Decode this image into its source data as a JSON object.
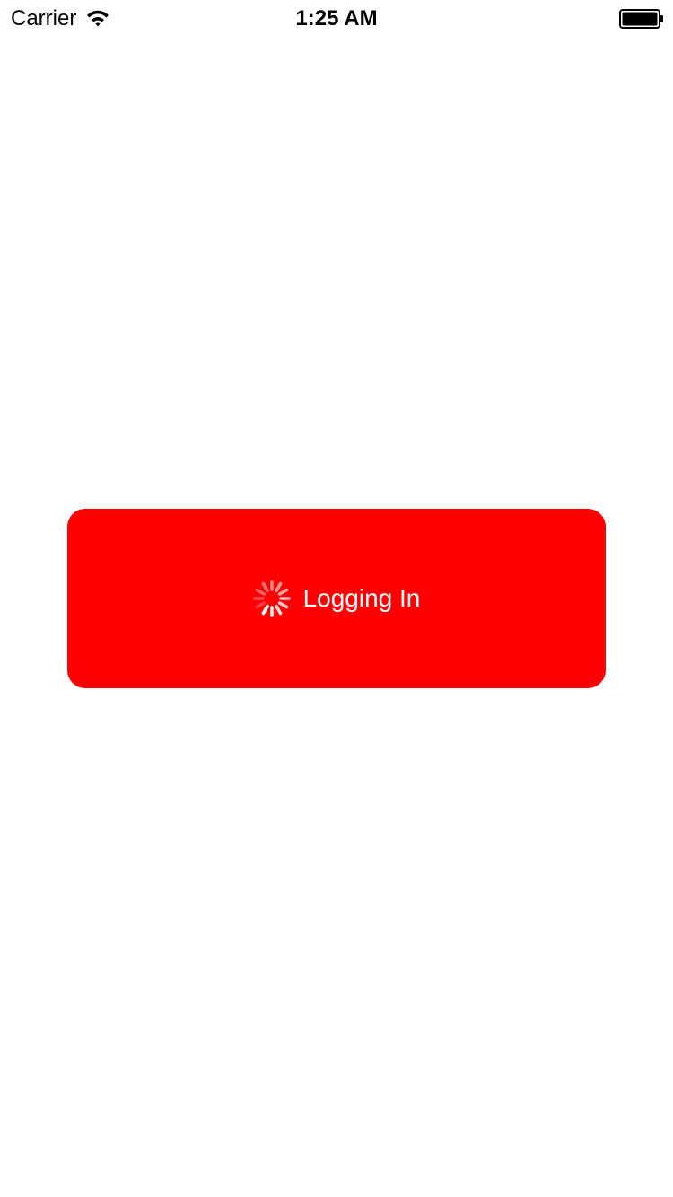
{
  "status_bar": {
    "carrier": "Carrier",
    "time": "1:25 AM",
    "wifi_icon": "wifi-icon",
    "battery_icon": "battery-full-icon"
  },
  "login_button": {
    "label": "Logging In",
    "spinner_icon": "activity-spinner-icon",
    "background_color": "#FF0000",
    "text_color": "#FFFFFF"
  }
}
